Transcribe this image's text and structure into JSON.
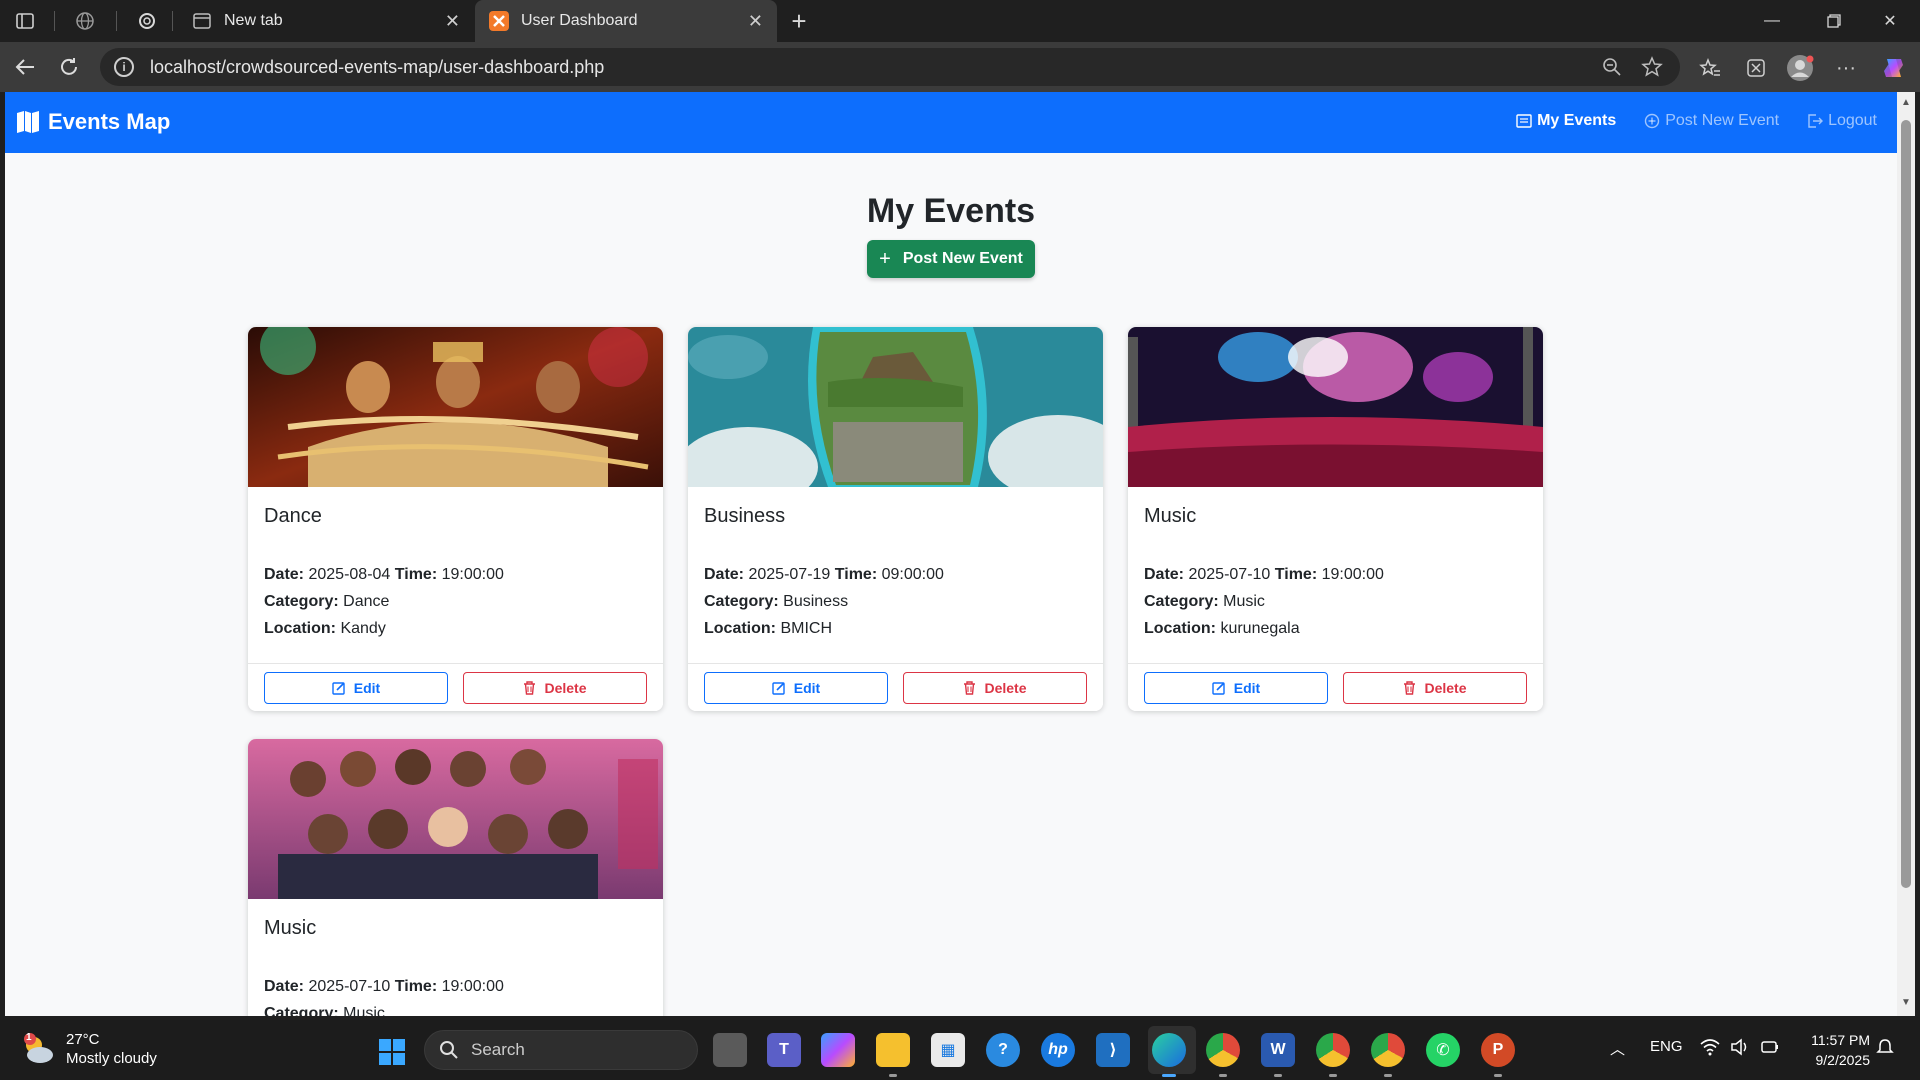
{
  "browser": {
    "tabs": [
      {
        "title": "New tab"
      },
      {
        "title": "User Dashboard"
      }
    ],
    "url": "localhost/crowdsourced-events-map/user-dashboard.php"
  },
  "navbar": {
    "brand": "Events Map",
    "links": [
      {
        "label": "My Events"
      },
      {
        "label": "Post New Event"
      },
      {
        "label": "Logout"
      }
    ]
  },
  "main": {
    "title": "My Events",
    "post_button": "Post New Event",
    "labels": {
      "date": "Date:",
      "time": "Time:",
      "category": "Category:",
      "location": "Location:"
    },
    "edit_label": "Edit",
    "delete_label": "Delete",
    "events": [
      {
        "title": "Dance",
        "date": "2025-08-04",
        "time": "19:00:00",
        "category": "Dance",
        "location": "Kandy",
        "image": "dancers-photo"
      },
      {
        "title": "Business",
        "date": "2025-07-19",
        "time": "09:00:00",
        "category": "Business",
        "location": "BMICH",
        "image": "rock-fortress-aerial-photo"
      },
      {
        "title": "Music",
        "date": "2025-07-10",
        "time": "19:00:00",
        "category": "Music",
        "location": "kurunegala",
        "image": "concert-crowd-photo"
      },
      {
        "title": "Music",
        "date": "2025-07-10",
        "time": "19:00:00",
        "category": "Music",
        "location": "",
        "image": "band-poster-photo"
      }
    ]
  },
  "taskbar": {
    "weather_temp": "27°C",
    "weather_desc": "Mostly cloudy",
    "weather_badge": "1",
    "search_placeholder": "Search",
    "language": "ENG",
    "time": "11:57 PM",
    "date": "9/2/2025"
  }
}
